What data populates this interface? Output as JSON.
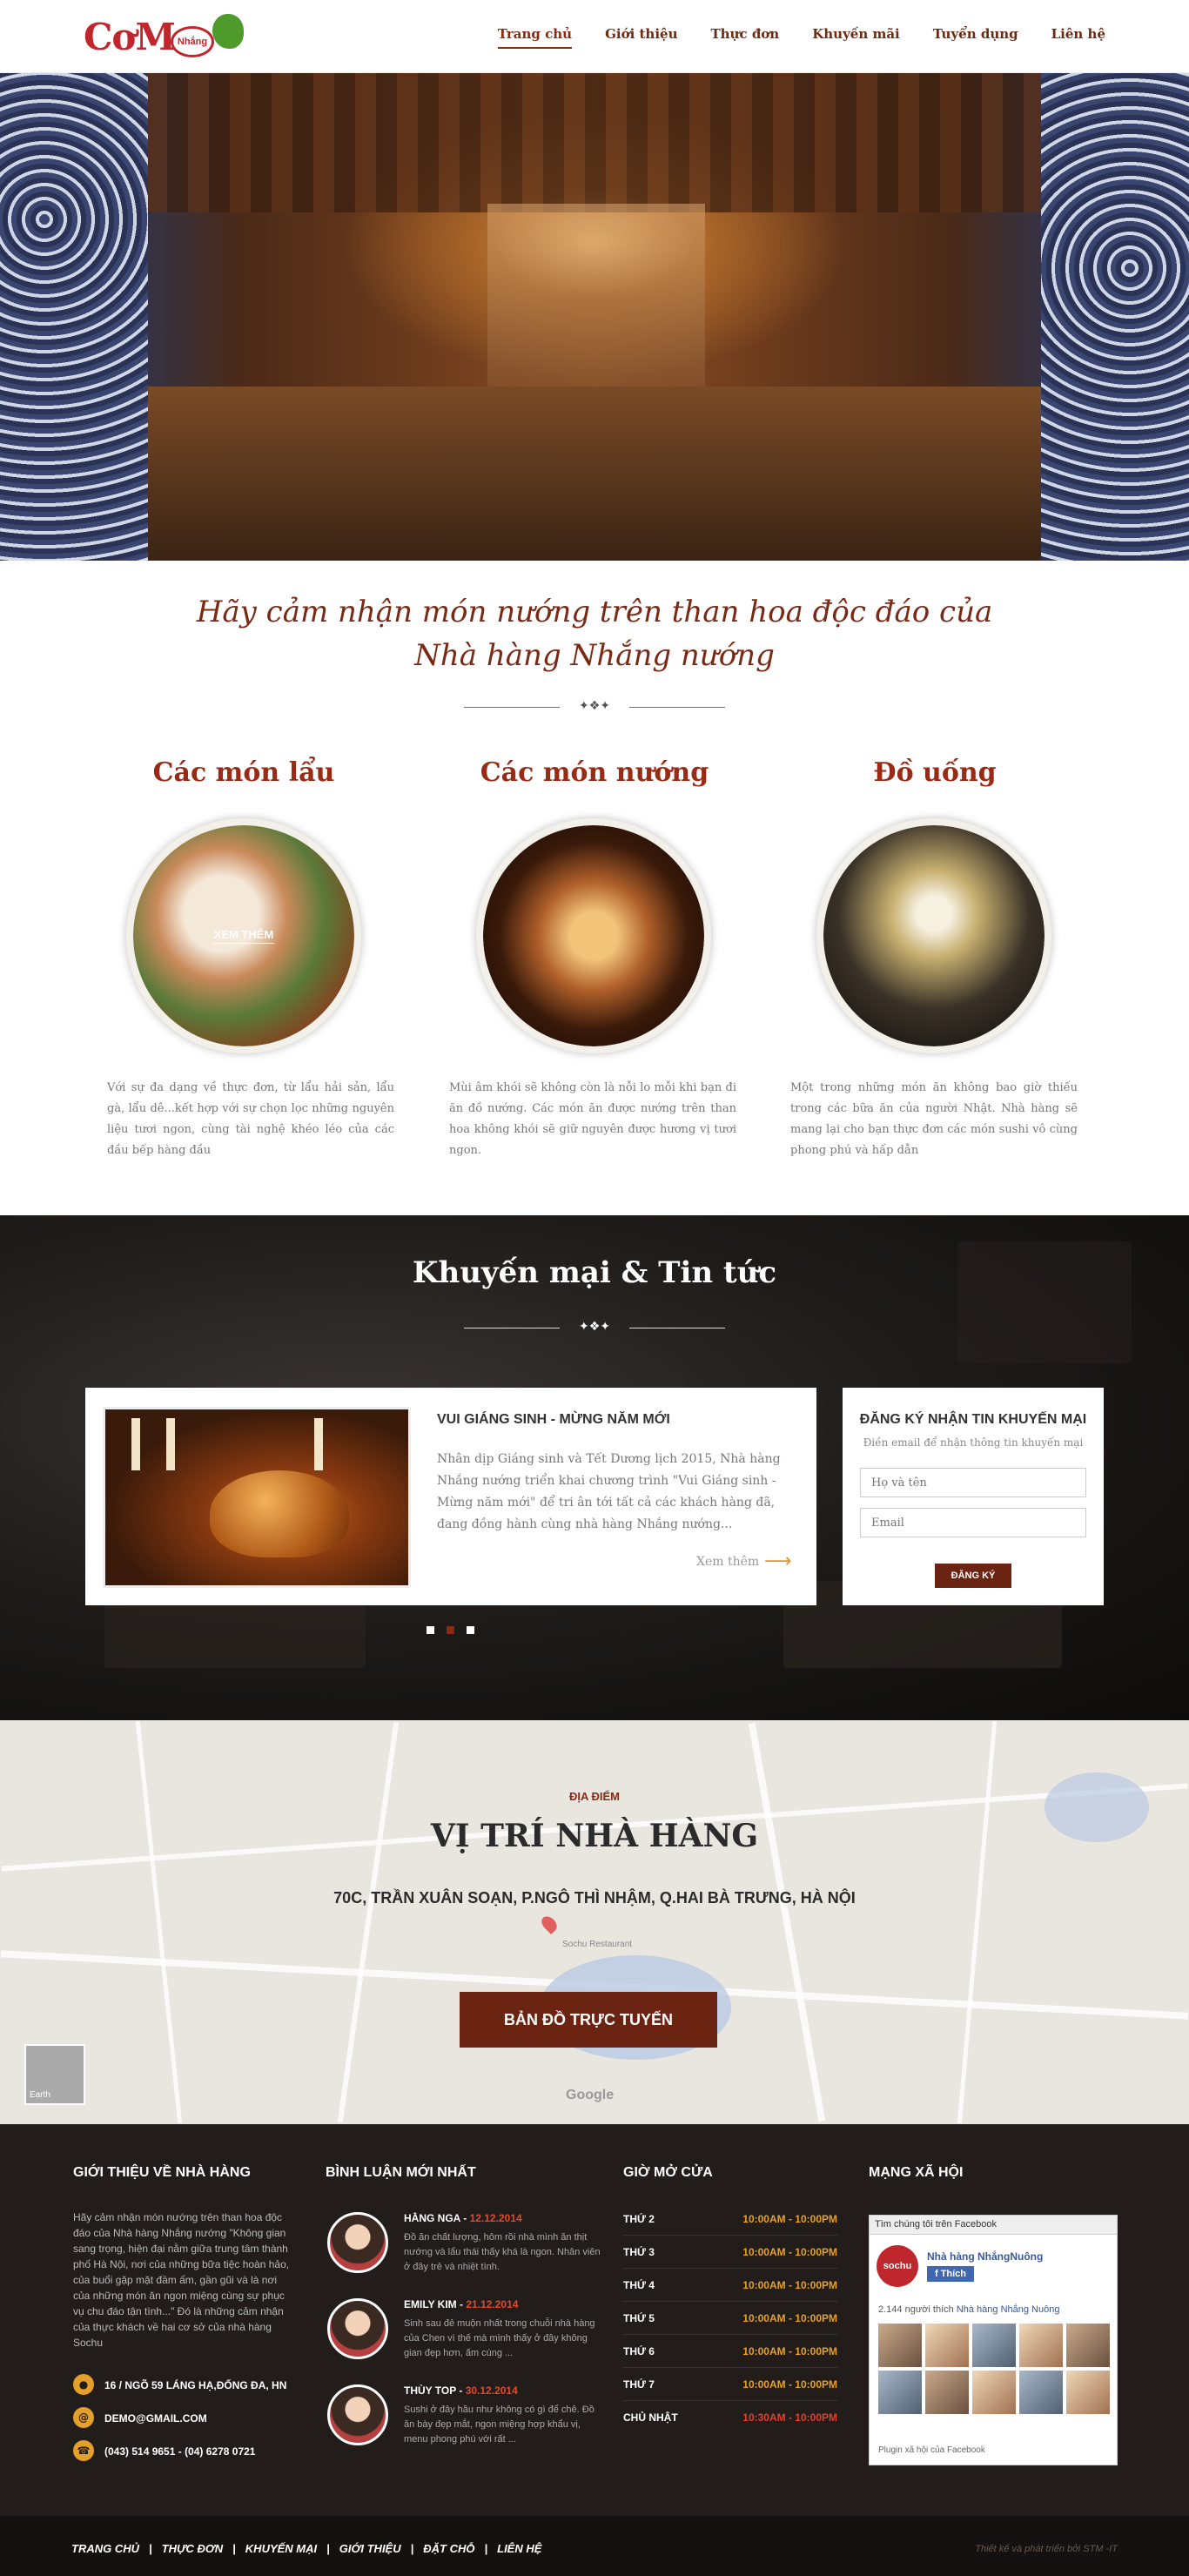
{
  "nav": {
    "items": [
      "Trang chủ",
      "Giới thiệu",
      "Thực đơn",
      "Khuyến mãi",
      "Tuyển dụng",
      "Liên hệ"
    ],
    "active": "Trang chủ"
  },
  "logo": {
    "text": "CơM",
    "badge": "Nhắng"
  },
  "intro": {
    "line1": "Hãy cảm nhận món nướng trên than hoa độc đáo của",
    "line2": "Nhà hàng Nhắng nướng"
  },
  "categories": [
    {
      "title": "Các món lẩu",
      "overlay": "XEM THÊM",
      "text": "Với sự đa dạng về thực đơn, từ lẩu hải sản, lẩu gà, lẩu dê...kết hợp với sự chọn lọc những nguyên liệu tươi ngon, cùng tài nghệ khéo léo của các đầu bếp hàng đầu"
    },
    {
      "title": "Các món nướng",
      "overlay": "",
      "text": "Mùi âm khói sẽ không còn là nỗi lo mỗi khi bạn đi ăn đồ nướng. Các món ăn được nướng trên than hoa không khói sẽ giữ nguyên được hương vị tươi ngon."
    },
    {
      "title": "Đồ uống",
      "overlay": "",
      "text": "Một trong những món ăn không bao giờ thiếu trong các bữa ăn của người Nhật. Nhà hàng sẽ mang lại cho bạn thực đơn các món sushi vô cùng phong phú và hấp dẫn"
    }
  ],
  "promo": {
    "title": "Khuyến mại & Tin tức",
    "news": {
      "title": "VUI GIÁNG SINH - MỪNG NĂM MỚI",
      "body": "Nhân dịp Giáng sinh và Tết Dương lịch 2015, Nhà hàng Nhắng nướng triển khai chương trình \"Vui Giáng sinh - Mừng năm mới\" để tri ân tới tất cả các khách hàng đã, đang đồng hành cùng nhà hàng Nhắng nướng...",
      "more": "Xem thêm"
    },
    "subscribe": {
      "title": "ĐĂNG KÝ NHẬN TIN KHUYẾN MẠI",
      "desc": "Điền email để nhận thông tin khuyến mại",
      "name_placeholder": "Họ và tên",
      "email_placeholder": "Email",
      "button": "ĐĂNG KÝ"
    },
    "slide_count": 3,
    "active_slide": 2
  },
  "map": {
    "sub": "ĐỊA ĐIỂM",
    "title": "VỊ TRÍ NHÀ HÀNG",
    "address": "70C, TRẦN XUÂN SOẠN, P.NGÔ THÌ NHẬM, Q.HAI BÀ TRƯNG, HÀ NỘI",
    "button": "BẢN ĐỒ TRỰC TUYẾN",
    "thumb_label": "Earth",
    "google": "Google",
    "pin_label": "Sochu Restaurant"
  },
  "footer": {
    "about": {
      "heading": "GIỚI THIỆU VỀ NHÀ HÀNG",
      "text": "Hãy cảm nhận món nướng trên than hoa độc đáo của Nhà hàng Nhắng nướng \"Không gian sang trọng, hiện đại nằm giữa trung tâm thành phố Hà Nội, nơi của những bữa tiệc hoàn hảo, của buổi gặp mặt đầm ấm, gần gũi và là nơi của những món ăn ngon miệng cùng sự phục vụ chu đáo tận tình...\" Đó là những cảm nhận của thực khách về hai cơ sở của nhà hàng Sochu",
      "address": "16 / NGÕ 59 LÁNG HẠ,ĐỐNG ĐA, HN",
      "email": "DEMO@GMAIL.COM",
      "phone": "(043) 514 9651 - (04) 6278 0721"
    },
    "comments": {
      "heading": "BÌNH LUẬN MỚI NHẤT",
      "items": [
        {
          "name": "HẰNG NGA",
          "date": "12.12.2014",
          "text": "Đồ ăn chất lượng, hôm rồi nhà mình ăn thịt nướng và lẩu thái thấy khá là ngon. Nhân viên ở đây trẻ và nhiệt tình."
        },
        {
          "name": "EMILY KIM",
          "date": "21.12.2014",
          "text": "Sinh sau đẻ muộn nhất trong chuỗi nhà hàng của Chen vì thế mà mình thấy ở đây không gian đẹp hơn, ấm cúng ..."
        },
        {
          "name": "THÙY TOP",
          "date": "30.12.2014",
          "text": "Sushi ở đây hầu như không có gì để chê. Đồ ăn bày đẹp mắt, ngon miệng hợp khẩu vị, menu phong phú với rất ..."
        }
      ]
    },
    "hours": {
      "heading": "GIỜ MỞ CỬA",
      "rows": [
        {
          "day": "THỨ 2",
          "time": "10:00AM - 10:00PM"
        },
        {
          "day": "THỨ 3",
          "time": "10:00AM - 10:00PM"
        },
        {
          "day": "THỨ 4",
          "time": "10:00AM - 10:00PM"
        },
        {
          "day": "THỨ 5",
          "time": "10:00AM - 10:00PM"
        },
        {
          "day": "THỨ 6",
          "time": "10:00AM - 10:00PM"
        },
        {
          "day": "THỨ 7",
          "time": "10:00AM - 10:00PM"
        },
        {
          "day": "CHỦ NHẬT",
          "time": "10:30AM - 10:00PM"
        }
      ]
    },
    "social": {
      "heading": "MẠNG XÃ HỘI",
      "fb_top": "Tìm chúng tôi trên Facebook",
      "page_name": "Nhà hàng NhắngNuông",
      "logo_text": "sochu",
      "like": "Thích",
      "count_prefix": "2.144 người thích",
      "count_link": "Nhà hàng Nhắng  Nuông",
      "plugin": "Plugin xã hội của Facebook"
    }
  },
  "bottom": {
    "links": [
      "TRANG CHỦ",
      "THỰC ĐƠN",
      "KHUYẾN MẠI",
      "GIỚI THIỆU",
      "ĐẶT CHỖ",
      "LIÊN HỆ"
    ],
    "credit": "Thiết kế và phát triển bởi STM -IT"
  },
  "colors": {
    "brand": "#6b2412",
    "accent": "#e4a02a",
    "heading": "#9a2a14"
  }
}
